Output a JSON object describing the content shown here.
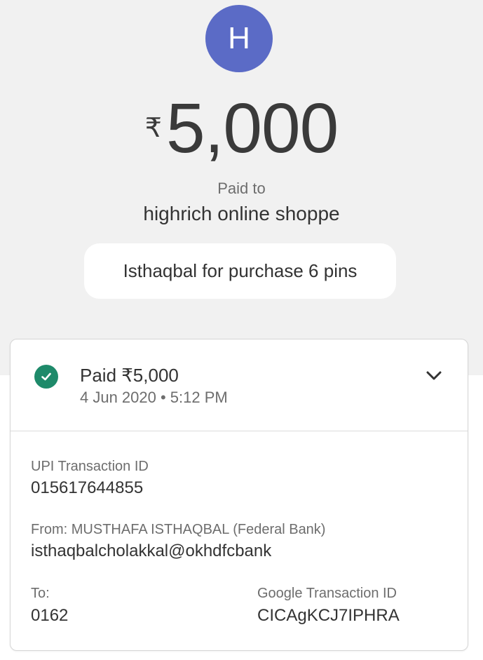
{
  "header": {
    "avatar_letter": "H",
    "currency_symbol": "₹",
    "amount": "5,000",
    "paid_to_label": "Paid to",
    "payee_name": "highrich online shoppe",
    "note": "Isthaqbal for purchase 6 pins"
  },
  "status": {
    "title": "Paid ₹5,000",
    "date": "4 Jun 2020 • 5:12 PM",
    "icon": "check-circle-icon",
    "expand_icon": "chevron-down-icon"
  },
  "details": {
    "upi_label": "UPI Transaction ID",
    "upi_value": "015617644855",
    "from_label": "From: MUSTHAFA ISTHAQBAL (Federal Bank)",
    "from_value": "isthaqbalcholakkal@okhdfcbank",
    "to_label": "To:",
    "to_value": "0162",
    "google_label": "Google Transaction ID",
    "google_value": "CICAgKCJ7IPHRA"
  },
  "colors": {
    "avatar": "#5b6bc6",
    "success": "#1e8a6a",
    "background_top": "#f1f1f1"
  }
}
